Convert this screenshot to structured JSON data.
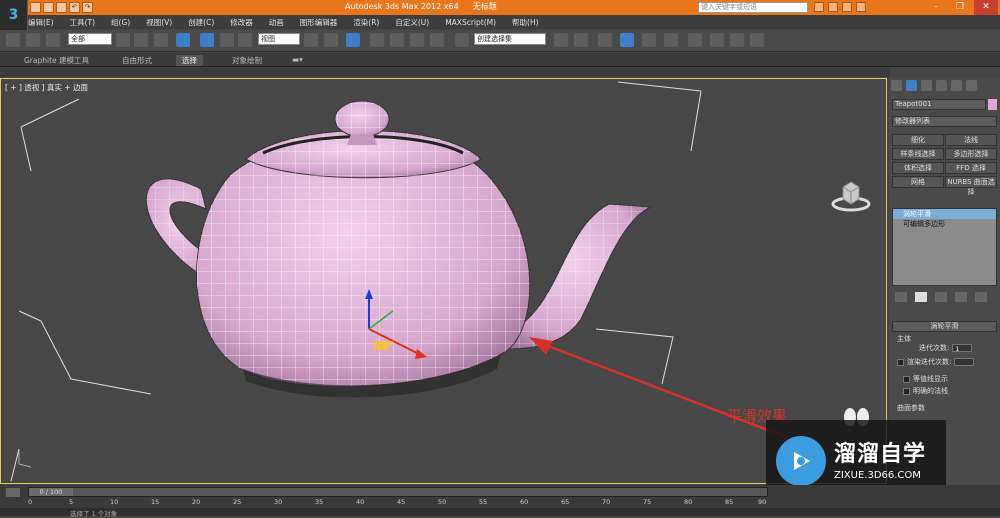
{
  "app": {
    "title": "Autodesk 3ds Max  2012 x64",
    "document": "无标题",
    "search_placeholder": "键入关键字或短语",
    "accent_color": "#e8761c"
  },
  "window_controls": {
    "minimize": "–",
    "restore": "❐",
    "close": "✕"
  },
  "menubar": [
    "编辑(E)",
    "工具(T)",
    "组(G)",
    "视图(V)",
    "创建(C)",
    "修改器",
    "动画",
    "图形编辑器",
    "渲染(R)",
    "自定义(U)",
    "MAXScript(M)",
    "帮助(H)"
  ],
  "toolbar": {
    "selection_filter": "全部",
    "reference_coord": "视图",
    "named_selection": "创建选择集"
  },
  "ribbon": {
    "tabs": [
      "Graphite 建模工具",
      "自由形式",
      "选择",
      "对象绘制"
    ]
  },
  "viewport": {
    "label": "[ + ] 透视 ] 真实 + 边面"
  },
  "command_panel": {
    "object_name": "Teapot001",
    "modifier_list": "修改器列表",
    "buttons": [
      "细化",
      "法线",
      "样条线选择",
      "多边形选择",
      "体积选择",
      "FFD 选择",
      "网格",
      "NURBS 曲面选择"
    ],
    "stack": [
      "涡轮平滑",
      "可编辑多边形"
    ],
    "rollout_title": "涡轮平滑",
    "group_main": "主体",
    "iterations_label": "迭代次数:",
    "iterations_value": "1",
    "render_iters_label": "渲染迭代次数:",
    "isoline_label": "等值线显示",
    "explicit_normals_label": "明确的法线",
    "surface_params_label": "曲面参数"
  },
  "timeline": {
    "thumb_label": "0 / 100",
    "ticks": [
      "0",
      "5",
      "10",
      "15",
      "20",
      "25",
      "30",
      "35",
      "40",
      "45",
      "50",
      "55",
      "60",
      "65",
      "70",
      "75",
      "80",
      "85",
      "90"
    ]
  },
  "status": {
    "text": "选择了 1 个对象"
  },
  "annotation": {
    "text": "平滑效果",
    "color": "#d3312a"
  },
  "watermark": {
    "title": "溜溜自学",
    "url": "ZIXUE.3D66.COM"
  }
}
